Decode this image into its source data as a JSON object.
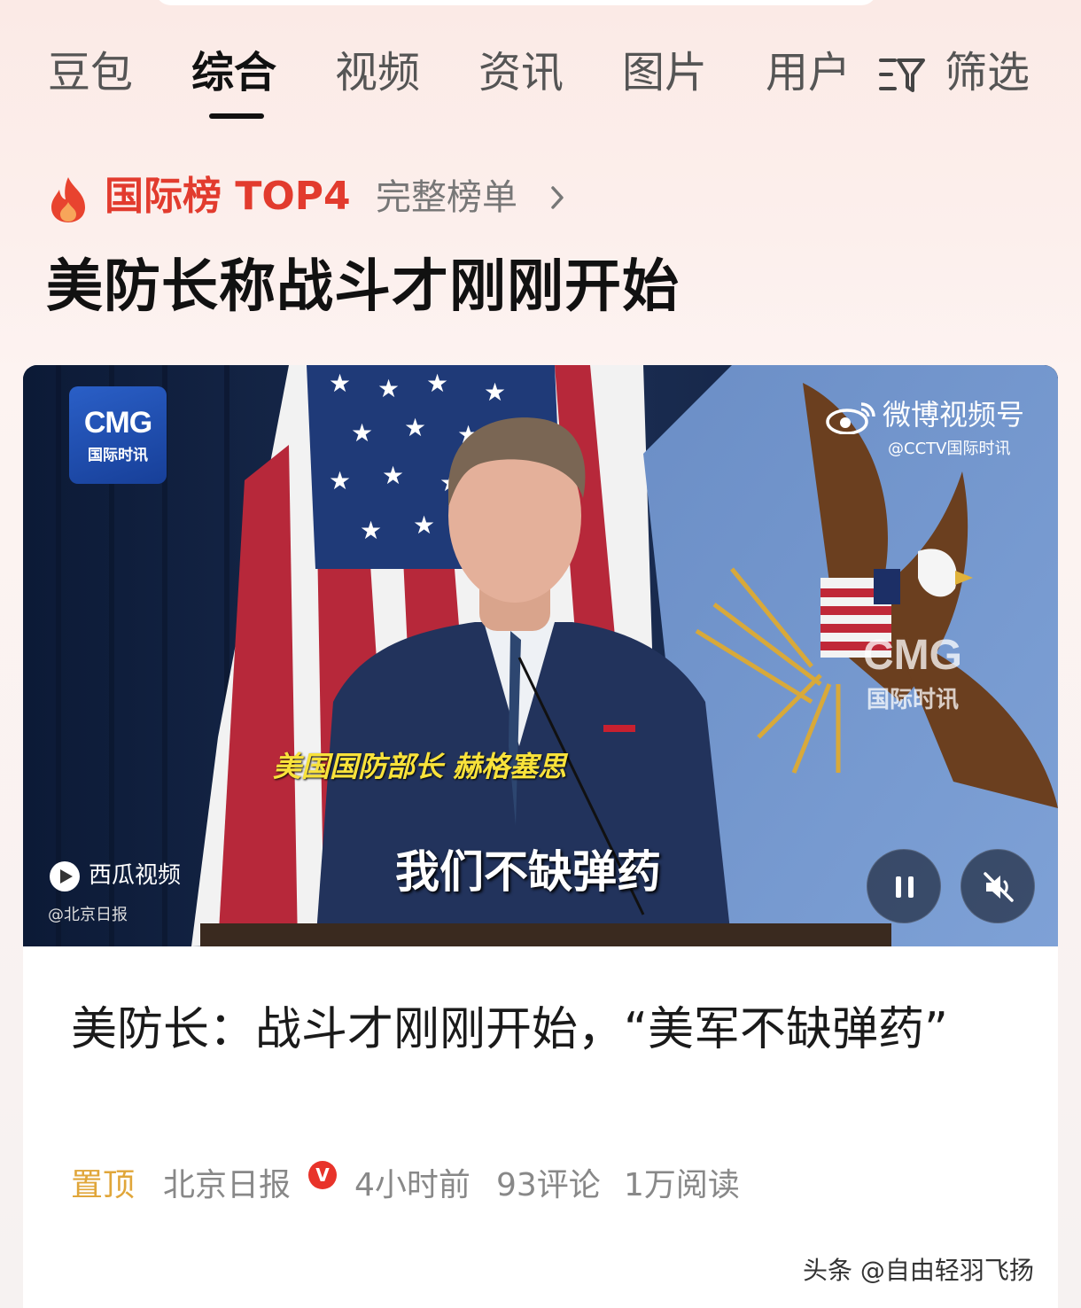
{
  "tabs": [
    {
      "label": "豆包"
    },
    {
      "label": "综合",
      "active": true
    },
    {
      "label": "视频"
    },
    {
      "label": "资讯"
    },
    {
      "label": "图片"
    },
    {
      "label": "用户"
    }
  ],
  "filter": {
    "label": "筛选",
    "icon": "filter-icon"
  },
  "rank": {
    "label": "国际榜 TOP4",
    "link": "完整榜单",
    "icon": "flame-icon",
    "color": "#e23b2e"
  },
  "headline": "美防长称战斗才刚刚开始",
  "video": {
    "logo_main": "CMG",
    "logo_sub": "国际时讯",
    "weibo_name": "微博视频号",
    "weibo_handle": "@CCTV国际时讯",
    "watermark_main": "CMG",
    "watermark_sub": "国际时讯",
    "caption_speaker": "美国国防部长 赫格塞思",
    "caption_quote": "我们不缺弹药",
    "platform": "西瓜视频",
    "source": "@北京日报",
    "controls": {
      "pause_icon": "pause-icon",
      "mute_icon": "muted-speaker-icon"
    }
  },
  "article": {
    "title": "美防长：战斗才刚刚开始，“美军不缺弹药”",
    "pinned": "置顶",
    "publisher": "北京日报",
    "verified_badge": "V",
    "time": "4小时前",
    "comments": "93评论",
    "reads": "1万阅读"
  },
  "watermark": "头条 @自由轻羽飞扬"
}
